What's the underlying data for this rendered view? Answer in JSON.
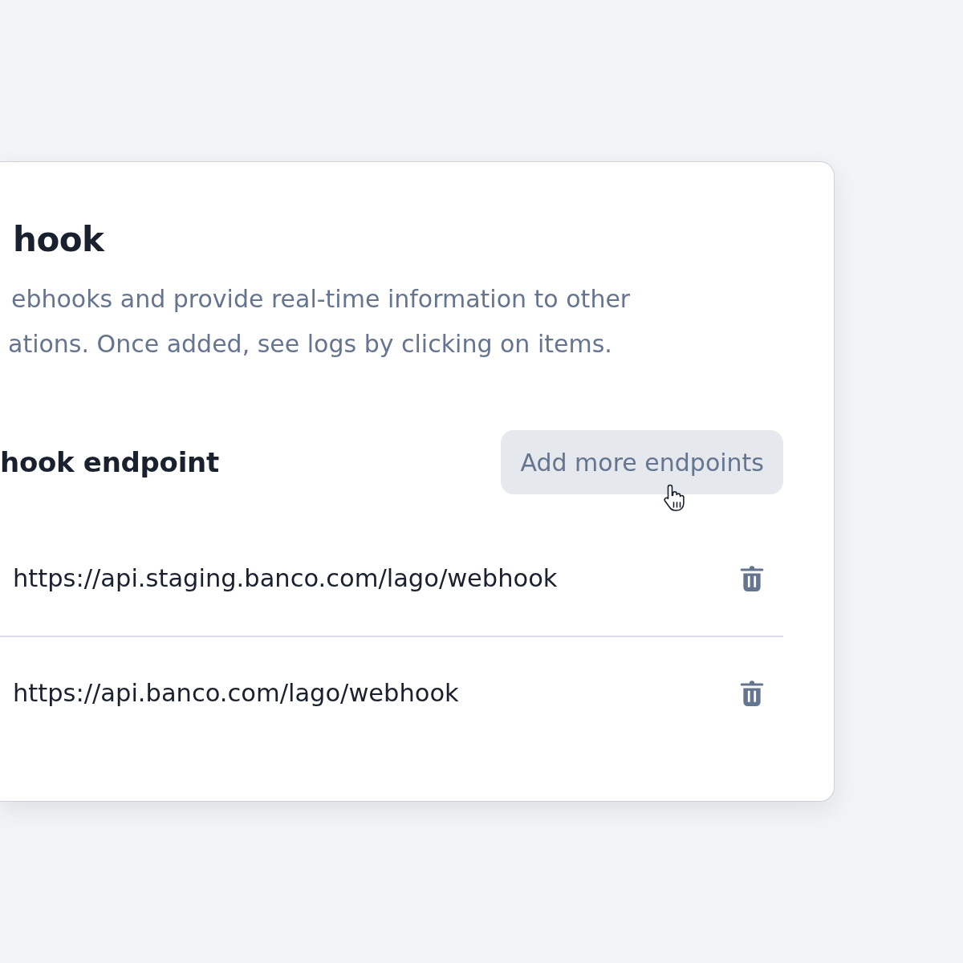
{
  "card": {
    "title": "hook",
    "description_lines": [
      "ebhooks and provide real-time information to other",
      "ations. Once added, see logs by clicking on items."
    ],
    "section_title": "hook endpoint",
    "add_button": {
      "label": "Add more endpoints"
    },
    "endpoints": [
      {
        "url": "https://api.staging.banco.com/lago/webhook"
      },
      {
        "url": "https://api.banco.com/lago/webhook"
      }
    ]
  }
}
